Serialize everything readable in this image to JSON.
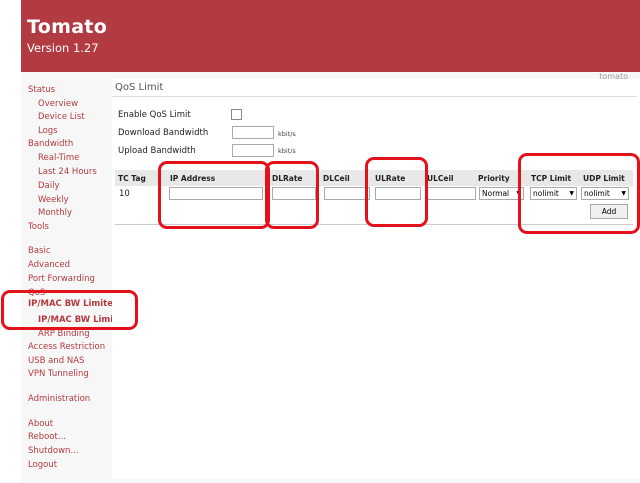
{
  "app": {
    "title": "Tomato",
    "version": "Version 1.27",
    "hostname": "tomato"
  },
  "nav": {
    "status": "Status",
    "overview": "Overview",
    "device_list": "Device List",
    "logs": "Logs",
    "bandwidth": "Bandwidth",
    "realtime": "Real-Time",
    "last24": "Last 24 Hours",
    "daily": "Daily",
    "weekly": "Weekly",
    "monthly": "Monthly",
    "tools": "Tools",
    "basic": "Basic",
    "advanced": "Advanced",
    "port_forwarding": "Port Forwarding",
    "qos": "QoS",
    "ipmac_bw_limiter": "IP/MAC BW Limiter",
    "ipmac_bw_limit": "IP/MAC BW Limit",
    "arp_binding": "ARP Binding",
    "access_restriction": "Access Restriction",
    "usb_nas": "USB and NAS",
    "vpn": "VPN Tunneling",
    "administration": "Administration",
    "about": "About",
    "reboot": "Reboot...",
    "shutdown": "Shutdown...",
    "logout": "Logout"
  },
  "page": {
    "section_title": "QoS Limit",
    "enable_label": "Enable QoS Limit",
    "download_label": "Download Bandwidth",
    "upload_label": "Upload Bandwidth",
    "unit": "kbit/s"
  },
  "table": {
    "headers": [
      "TC Tag",
      "IP Address",
      "DLRate",
      "DLCeil",
      "ULRate",
      "ULCeil",
      "Priority",
      "TCP Limit",
      "UDP Limit"
    ],
    "row": {
      "tc_tag": "10",
      "priority": "Normal",
      "tcp": "nolimit",
      "udp": "nolimit"
    },
    "add_label": "Add"
  },
  "colors": {
    "brand": "#b23b41",
    "highlight": "#e3121a"
  }
}
